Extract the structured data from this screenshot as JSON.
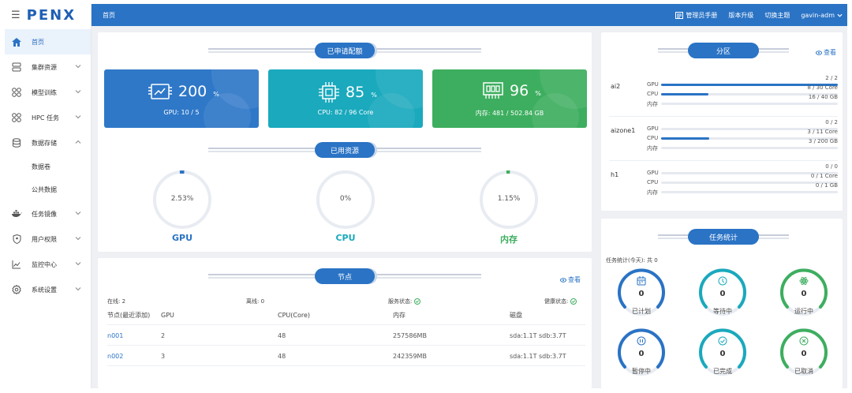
{
  "brand": {
    "logo": "PENX"
  },
  "sidebar": {
    "items": [
      {
        "label": "首页",
        "icon": "home-icon",
        "active": true,
        "expandable": false
      },
      {
        "label": "集群资源",
        "icon": "server-icon",
        "active": false,
        "expandable": true
      },
      {
        "label": "模型训练",
        "icon": "grid-icon",
        "active": false,
        "expandable": true
      },
      {
        "label": "HPC 任务",
        "icon": "grid-icon",
        "active": false,
        "expandable": true
      },
      {
        "label": "数据存储",
        "icon": "database-icon",
        "active": false,
        "expandable": true,
        "expanded": true
      }
    ],
    "sub_items": [
      {
        "label": "数据卷"
      },
      {
        "label": "公共数据"
      }
    ],
    "items_after": [
      {
        "label": "任务镜像",
        "icon": "docker-icon",
        "expandable": true
      },
      {
        "label": "用户权限",
        "icon": "shield-icon",
        "expandable": true
      },
      {
        "label": "监控中心",
        "icon": "chart-icon",
        "expandable": true
      },
      {
        "label": "系统设置",
        "icon": "gear-icon",
        "expandable": true
      }
    ]
  },
  "topbar": {
    "title": "首页",
    "manual": "管理员手册",
    "upgrade": "版本升级",
    "theme": "切换主题",
    "user": "gavin-adm"
  },
  "quota": {
    "title": "已申请配额",
    "cards": [
      {
        "value": "200",
        "unit": "%",
        "detail": "GPU: 10 / 5",
        "color": "#2f78c8",
        "icon": "gpu-icon"
      },
      {
        "value": "85",
        "unit": "%",
        "detail": "CPU: 82 / 96 Core",
        "color": "#1aa9bd",
        "icon": "cpu-icon"
      },
      {
        "value": "96",
        "unit": "%",
        "detail": "内存: 481 / 502.84 GB",
        "color": "#3dae5f",
        "icon": "memory-icon"
      }
    ]
  },
  "used": {
    "title": "已用资源",
    "gauges": [
      {
        "label": "GPU",
        "value": "2.53%",
        "fraction": 0.0253,
        "color": "#2a73c5"
      },
      {
        "label": "CPU",
        "value": "0%",
        "fraction": 0,
        "color": "#1aa9bd"
      },
      {
        "label": "内存",
        "value": "1.15%",
        "fraction": 0.0115,
        "color": "#3dae5f"
      }
    ]
  },
  "partition": {
    "title": "分区",
    "view": "查看",
    "groups": [
      {
        "name": "ai2",
        "rows": [
          {
            "label": "GPU",
            "text": "2 / 2",
            "fraction": 1.0
          },
          {
            "label": "CPU",
            "text": "8 / 30 Core",
            "fraction": 0.267
          },
          {
            "label": "内存",
            "text": "16 / 40 GB",
            "fraction": 0.0
          }
        ]
      },
      {
        "name": "aizone1",
        "rows": [
          {
            "label": "GPU",
            "text": "0 / 2",
            "fraction": 0
          },
          {
            "label": "CPU",
            "text": "3 / 11 Core",
            "fraction": 0.273
          },
          {
            "label": "内存",
            "text": "3 / 200 GB",
            "fraction": 0.0
          }
        ]
      },
      {
        "name": "h1",
        "rows": [
          {
            "label": "GPU",
            "text": "0 / 0",
            "fraction": 0
          },
          {
            "label": "CPU",
            "text": "0 / 1 Core",
            "fraction": 0
          },
          {
            "label": "内存",
            "text": "0 / 1 GB",
            "fraction": 0
          }
        ]
      }
    ]
  },
  "nodes": {
    "title": "节点",
    "view": "查看",
    "online": "在线: 2",
    "offline": "离线: 0",
    "service": "服务状态:",
    "health": "健康状态:",
    "columns": [
      "节点(最近添加)",
      "GPU",
      "CPU(Core)",
      "内存",
      "磁盘"
    ],
    "rows": [
      [
        "n001",
        "2",
        "48",
        "257586MB",
        "sda:1.1T sdb:3.7T"
      ],
      [
        "n002",
        "3",
        "48",
        "242359MB",
        "sda:1.1T sdb:3.7T"
      ]
    ]
  },
  "tasks": {
    "title": "任务统计",
    "summary": "任务统计(今天): 共 0",
    "items": [
      {
        "label": "已计划",
        "count": "0",
        "color": "#2a73c5",
        "icon": "calendar-icon"
      },
      {
        "label": "等待中",
        "count": "0",
        "color": "#1aa9bd",
        "icon": "clock-icon"
      },
      {
        "label": "运行中",
        "count": "0",
        "color": "#3dae5f",
        "icon": "atom-icon"
      },
      {
        "label": "暂停中",
        "count": "0",
        "color": "#2a73c5",
        "icon": "pause-icon"
      },
      {
        "label": "已完成",
        "count": "0",
        "color": "#1aa9bd",
        "icon": "check-icon"
      },
      {
        "label": "已取消",
        "count": "0",
        "color": "#3dae5f",
        "icon": "close-circle-icon"
      }
    ]
  }
}
